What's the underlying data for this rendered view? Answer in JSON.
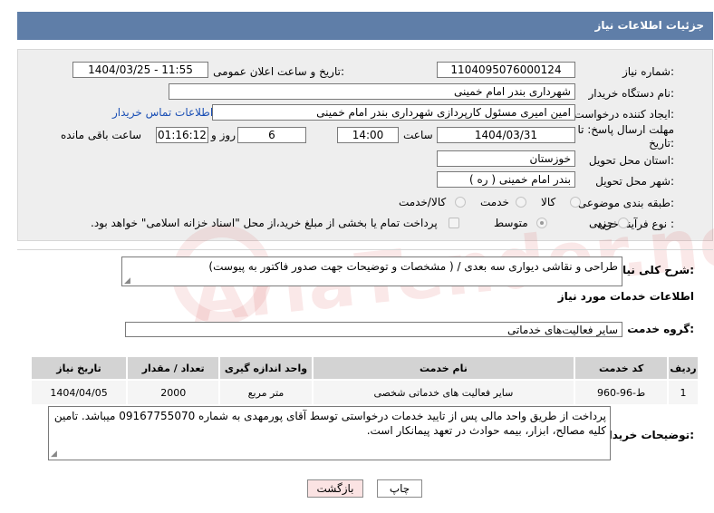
{
  "header": {
    "title": "جزئیات اطلاعات نیاز"
  },
  "watermark": {
    "text": "AriaTender.net"
  },
  "form": {
    "need_number_label": "شماره نیاز:",
    "need_number": "1104095076000124",
    "announce_label": "تاریخ و ساعت اعلان عمومی:",
    "announce_value": "1404/03/25 - 11:55",
    "buyer_org_label": "نام دستگاه خریدار:",
    "buyer_org": "شهرداری بندر امام خمینی",
    "creator_label": "ایجاد کننده درخواست:",
    "creator": "امین امیری مسئول کارپردازی شهرداری بندر امام خمینی",
    "contact_link": "اطلاعات تماس خریدار",
    "deadline_label_1": "مهلت ارسال پاسخ: تا",
    "deadline_label_2": "تاریخ:",
    "deadline_date": "1404/03/31",
    "time_label": "ساعت",
    "deadline_time": "14:00",
    "days_value": "6",
    "days_label": "روز و",
    "remaining_time": "01:16:12",
    "remaining_label": "ساعت باقی مانده",
    "province_label": "استان محل تحویل:",
    "province": "خوزستان",
    "city_label": "شهر محل تحویل:",
    "city": "بندر امام خمینی ( ره )",
    "category_label": "طبقه بندی موضوعی:",
    "category_options": [
      "کالا",
      "خدمت",
      "کالا/خدمت"
    ],
    "category_selected": "خدمت",
    "process_label": "نوع فرآیند خرید :",
    "process_options": [
      "جزیی",
      "متوسط"
    ],
    "process_selected": "متوسط",
    "payment_note": "پرداخت تمام یا بخشی از مبلغ خرید،از محل \"اسناد خزانه اسلامی\" خواهد بود."
  },
  "summary": {
    "label": "شرح کلی نیاز:",
    "text": "طراحی و نقاشی دیواری سه بعدی /  ( مشخصات و توضیحات جهت صدور فاکتور به پیوست)"
  },
  "services": {
    "section_title": "اطلاعات خدمات مورد نیاز",
    "group_label": "گروه خدمت:",
    "group_value": "سایر فعالیت‌های خدماتی",
    "columns": [
      "ردیف",
      "کد خدمت",
      "نام خدمت",
      "واحد اندازه گیری",
      "تعداد / مقدار",
      "تاریخ نیاز"
    ],
    "rows": [
      [
        "1",
        "ط-96-960",
        "سایر فعالیت های خدماتی شخصی",
        "متر مربع",
        "2000",
        "1404/04/05"
      ]
    ]
  },
  "buyer_notes": {
    "label": "توضیحات خریدار:",
    "text": "پرداخت از طریق واحد مالی پس از تایید خدمات درخواستی توسط آقای پورمهدی به شماره 09167755070 میباشد.  تامین کلیه مصالح، ابزار، بیمه حوادث در تعهد پیمانکار است."
  },
  "buttons": {
    "print": "چاپ",
    "back": "بازگشت"
  }
}
